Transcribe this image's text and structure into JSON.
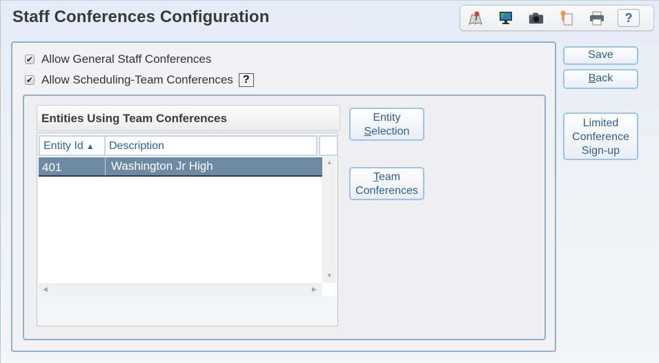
{
  "header": {
    "title": "Staff Conferences Configuration"
  },
  "toolbar": {
    "icons": [
      "map-pin-icon",
      "monitor-icon",
      "camera-icon",
      "copy-document-icon",
      "printer-icon",
      "help-icon"
    ],
    "help_label": "?"
  },
  "options": {
    "general": {
      "label": "Allow General Staff Conferences",
      "checked": true
    },
    "scheduling_team": {
      "label": "Allow Scheduling-Team Conferences",
      "checked": true
    },
    "help_label": "?"
  },
  "grid": {
    "title": "Entities Using Team Conferences",
    "columns": [
      {
        "label": "Entity Id",
        "sort": "ascending"
      },
      {
        "label": "Description"
      }
    ],
    "rows": [
      {
        "entity_id": "401",
        "description": "Washington Jr High",
        "selected": true
      }
    ]
  },
  "buttons": {
    "entity_selection": {
      "line1": "Entity",
      "line2_accel": "S",
      "line2_rest": "election"
    },
    "team_conferences": {
      "line1_accel": "T",
      "line1_rest": "eam",
      "line2": "Conferences"
    },
    "save": "Save",
    "back": {
      "accel": "B",
      "rest": "ack"
    },
    "limited_signup": {
      "line1": "Limited",
      "line2": "Conference",
      "line3": "Sign-up"
    }
  }
}
